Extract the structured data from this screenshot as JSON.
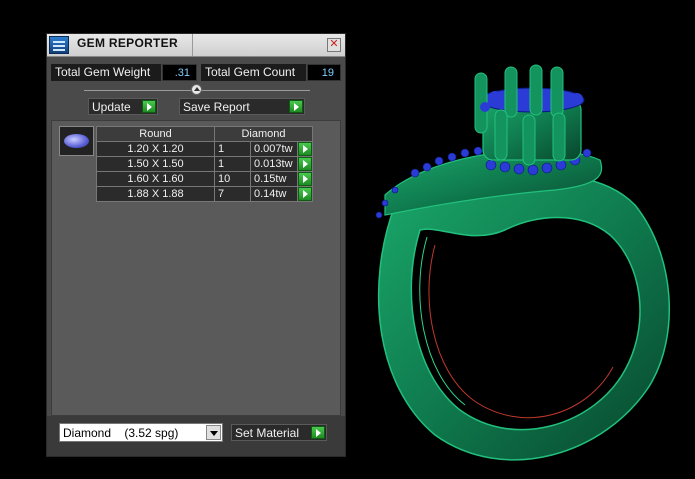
{
  "panel": {
    "title": "GEM REPORTER",
    "close_glyph": "✕",
    "total_gem_weight_label": "Total Gem Weight",
    "total_gem_weight_value": ".31",
    "total_gem_count_label": "Total Gem Count",
    "total_gem_count_value": "19",
    "update_label": "Update",
    "save_report_label": "Save Report"
  },
  "table": {
    "headers": [
      "Round",
      "Diamond"
    ],
    "rows": [
      {
        "size": "1.20 X 1.20",
        "qty": "1",
        "weight": "0.007tw"
      },
      {
        "size": "1.50 X 1.50",
        "qty": "1",
        "weight": "0.013tw"
      },
      {
        "size": "1.60 X 1.60",
        "qty": "10",
        "weight": "0.15tw"
      },
      {
        "size": "1.88 X 1.88",
        "qty": "7",
        "weight": "0.14tw"
      }
    ]
  },
  "material": {
    "selected": "Diamond    (3.52 spg)",
    "set_material_label": "Set Material"
  },
  "colors": {
    "ring_metal": "#0f7a4e",
    "gem_blue": "#2a3bd6",
    "accent_green": "#2fae35"
  },
  "icons": {
    "title": "gem-reporter-icon",
    "gem": "round-gem-icon",
    "go": "play-arrow-icon",
    "dropdown": "chevron-down-icon"
  }
}
